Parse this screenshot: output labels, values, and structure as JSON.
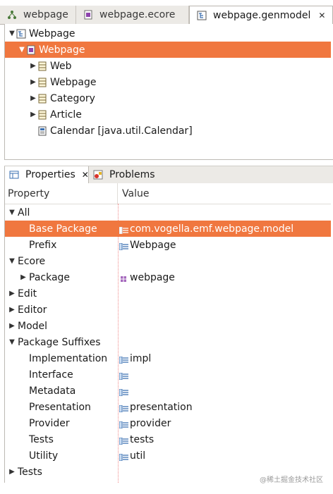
{
  "editor_tabs": [
    {
      "label": "webpage",
      "icon": "ecore-diagram-icon",
      "active": false
    },
    {
      "label": "webpage.ecore",
      "icon": "ecore-package-icon",
      "active": false
    },
    {
      "label": "webpage.genmodel",
      "icon": "genmodel-icon",
      "active": true,
      "close": "✕"
    }
  ],
  "tree": {
    "root_label": "Webpage",
    "selected_label": "Webpage",
    "items": [
      "Web",
      "Webpage",
      "Category",
      "Article"
    ],
    "datatype_label": "Calendar [java.util.Calendar]"
  },
  "view_tabs": {
    "properties_label": "Properties",
    "properties_close": "✕",
    "problems_label": "Problems"
  },
  "properties": {
    "col_property": "Property",
    "col_value": "Value",
    "rows": [
      {
        "label": "All",
        "value": ""
      },
      {
        "label": "Base Package",
        "value": "com.vogella.emf.webpage.model"
      },
      {
        "label": "Prefix",
        "value": "Webpage"
      },
      {
        "label": "Ecore",
        "value": ""
      },
      {
        "label": "Package",
        "value": "webpage"
      },
      {
        "label": "Edit",
        "value": ""
      },
      {
        "label": "Editor",
        "value": ""
      },
      {
        "label": "Model",
        "value": ""
      },
      {
        "label": "Package Suffixes",
        "value": ""
      },
      {
        "label": "Implementation",
        "value": "impl"
      },
      {
        "label": "Interface",
        "value": ""
      },
      {
        "label": "Metadata",
        "value": ""
      },
      {
        "label": "Presentation",
        "value": "presentation"
      },
      {
        "label": "Provider",
        "value": "provider"
      },
      {
        "label": "Tests",
        "value": "tests"
      },
      {
        "label": "Utility",
        "value": "util"
      },
      {
        "label": "Tests",
        "value": ""
      }
    ]
  },
  "colors": {
    "selection": "#f0773f",
    "accent": "#3a6fb0"
  },
  "watermark": "@稀土掘金技术社区"
}
